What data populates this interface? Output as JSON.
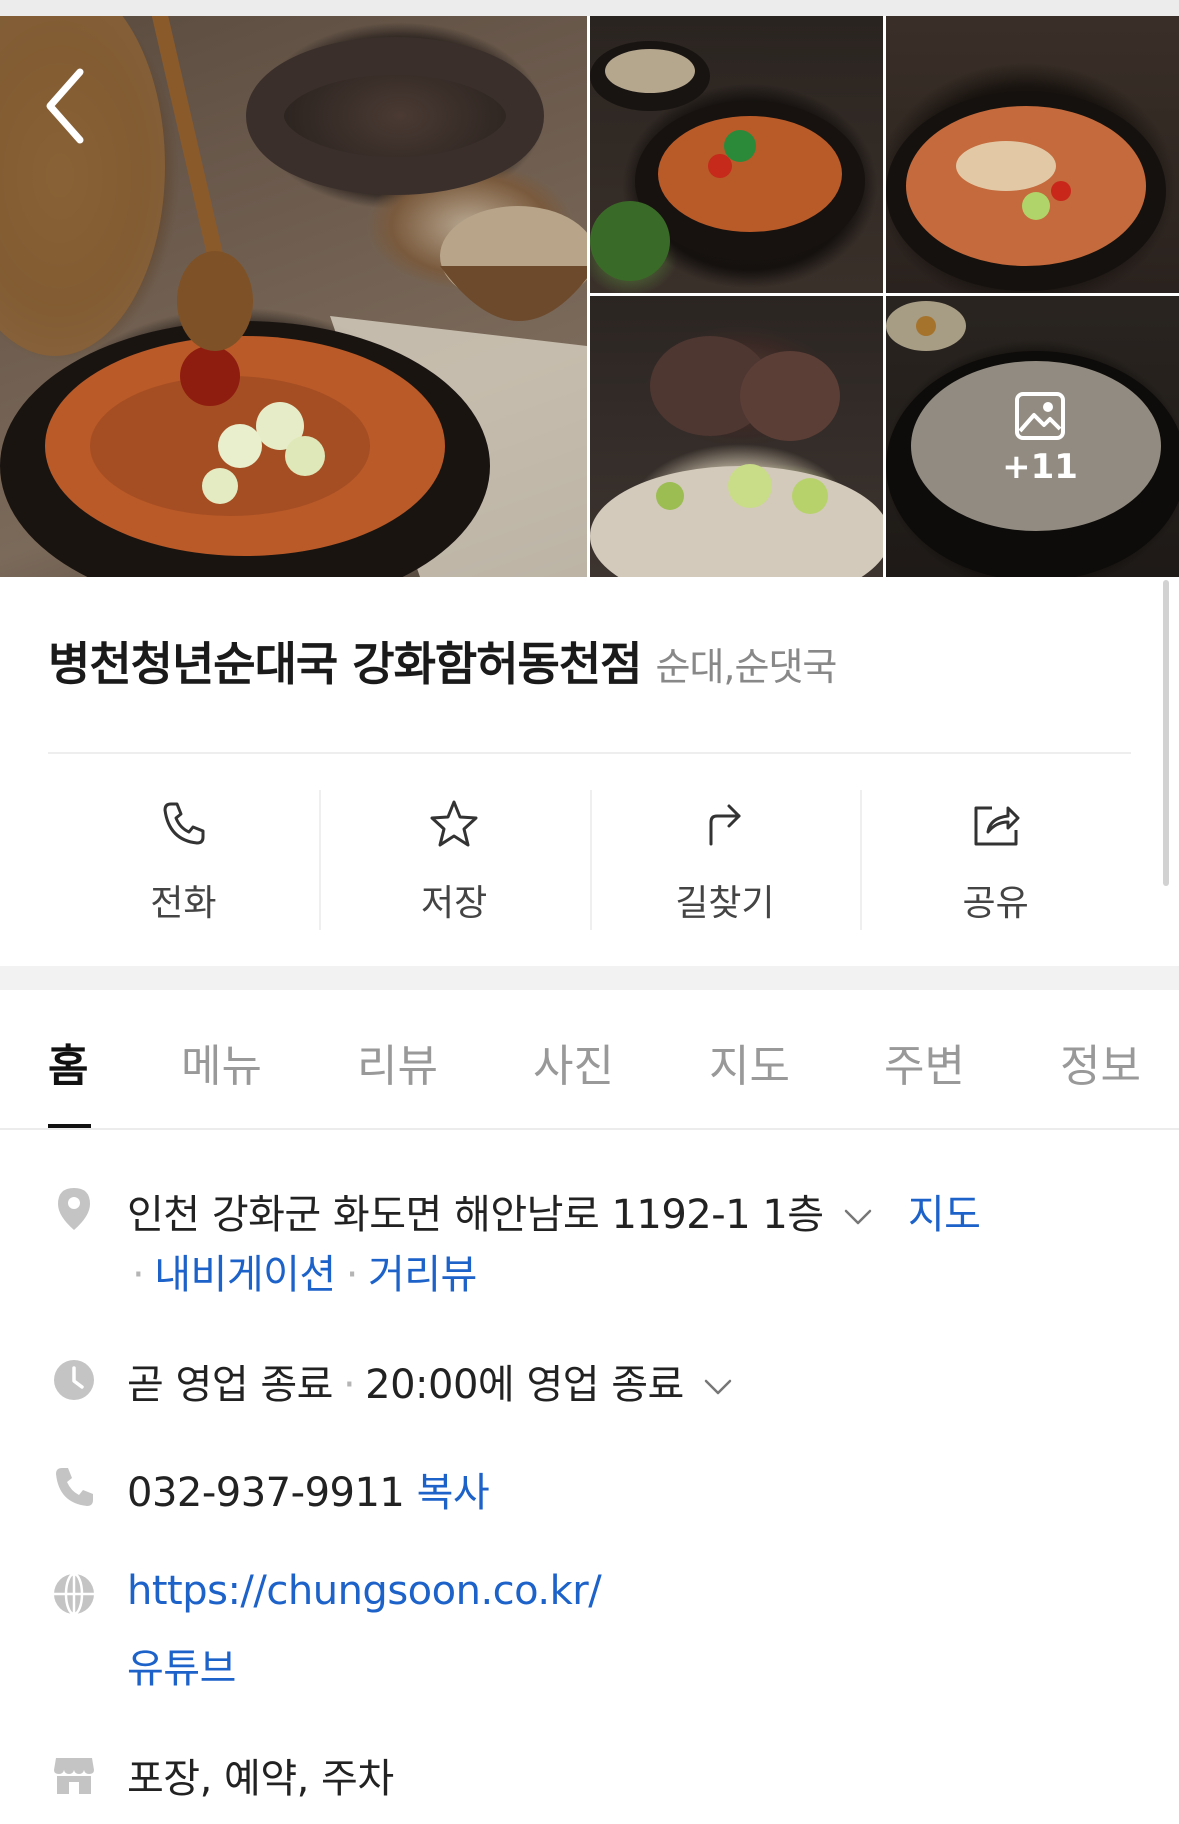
{
  "gallery": {
    "more_count": "+11"
  },
  "place": {
    "name": "병천청년순대국 강화함허동천점",
    "category": "순대,순댓국"
  },
  "actions": [
    {
      "label": "전화",
      "icon": "phone-icon"
    },
    {
      "label": "저장",
      "icon": "star-icon"
    },
    {
      "label": "길찾기",
      "icon": "directions-icon"
    },
    {
      "label": "공유",
      "icon": "share-icon"
    }
  ],
  "tabs": [
    "홈",
    "메뉴",
    "리뷰",
    "사진",
    "지도",
    "주변",
    "정보"
  ],
  "active_tab": "홈",
  "address": {
    "text": "인천 강화군 화도면 해안남로 1192-1 1층",
    "map_link": "지도",
    "navigation_link": "내비게이션",
    "streetview_link": "거리뷰"
  },
  "hours": {
    "status": "곧 영업 종료",
    "detail": "20:00에 영업 종료"
  },
  "phone": {
    "number": "032-937-9911",
    "copy_label": "복사"
  },
  "website": {
    "url": "https://chungsoon.co.kr/",
    "youtube": "유튜브"
  },
  "amenities": {
    "text": "포장, 예약, 주차"
  },
  "colors": {
    "link": "#1d62c9",
    "icon_gray": "#c4c4c4"
  }
}
